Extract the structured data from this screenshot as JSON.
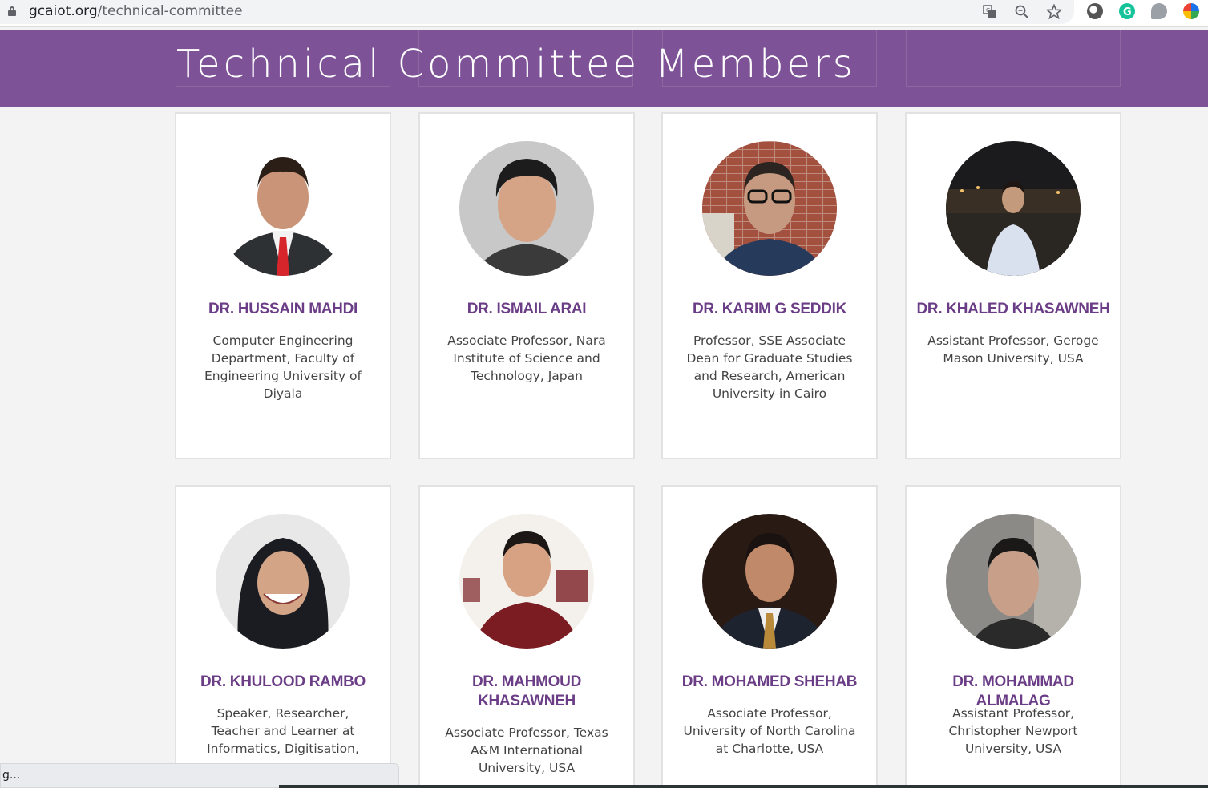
{
  "browser": {
    "url_domain": "gcaiot.org",
    "url_path": "/technical-committee",
    "status_text": "g..."
  },
  "page": {
    "title": "Technical Committee Members"
  },
  "colors": {
    "header_band": "#7e5296",
    "name_text": "#6b3d86",
    "background": "#f3f3f3"
  },
  "members": [
    {
      "name": "DR. HUSSAIN MAHDI",
      "role": "Computer Engineering Department, Faculty of Engineering University of Diyala"
    },
    {
      "name": "DR. ISMAIL ARAI",
      "role": "Associate Professor, Nara Institute of Science and Technology, Japan"
    },
    {
      "name": "DR. KARIM G SEDDIK",
      "role": "Professor, SSE Associate Dean for Graduate Studies and Research, American University in Cairo"
    },
    {
      "name": "DR. KHALED KHASAWNEH",
      "role": "Assistant Professor, Geroge Mason University, USA"
    },
    {
      "name": "DR. KHULOOD RAMBO",
      "role": "Speaker, Researcher, Teacher and Learner at Informatics, Digitisation, Water, Energy, and Food N..."
    },
    {
      "name": "DR. MAHMOUD KHASAWNEH",
      "role": "Associate Professor, Texas A&M International University, USA"
    },
    {
      "name": "DR. MOHAMED SHEHAB",
      "role": "Associate Professor, University of North Carolina at Charlotte, USA"
    },
    {
      "name": "DR. MOHAMMAD ALMALAG",
      "role": "Assistant Professor, Christopher Newport University, USA"
    }
  ]
}
